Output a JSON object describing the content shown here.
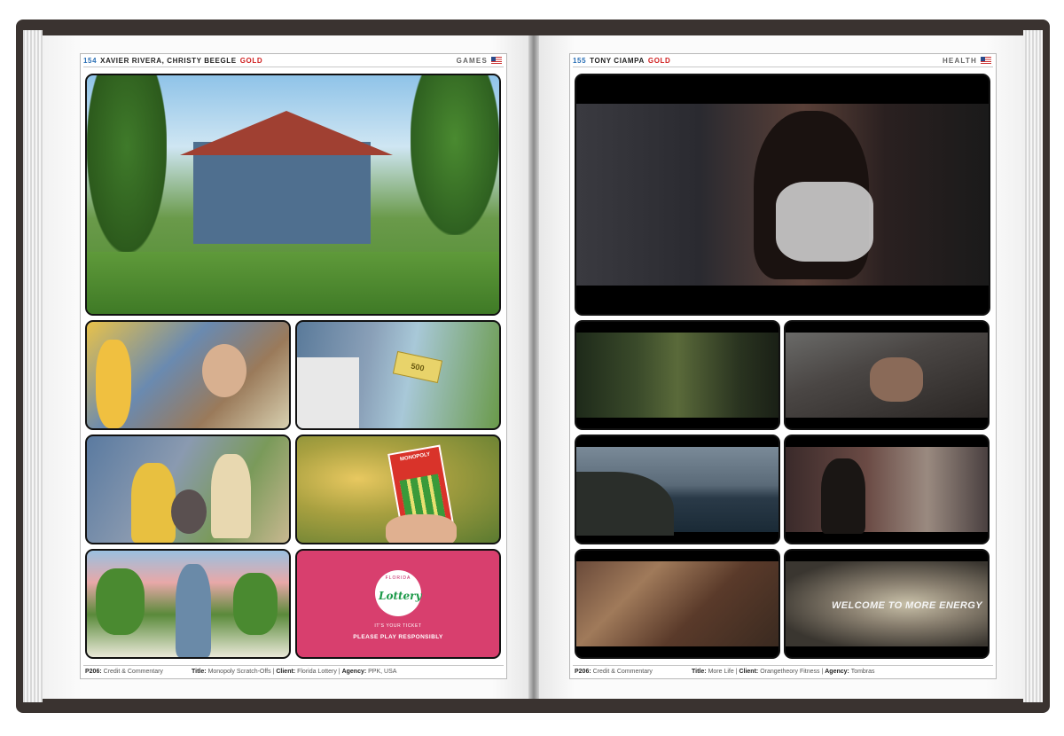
{
  "left_page": {
    "header": {
      "page_number": "154",
      "names": "XAVIER RIVERA, CHRISTY BEEGLE",
      "award": "GOLD",
      "category": "GAMES"
    },
    "footer": {
      "ref": "P206:",
      "ref_text": "Credit & Commentary",
      "title_label": "Title:",
      "title": "Monopoly Scratch-Offs",
      "client_label": "Client:",
      "client": "Florida Lottery",
      "agency_label": "Agency:",
      "agency": "PPK, USA"
    },
    "frames": [
      {
        "scene": "Blue craftsman house with red roof and green lawn"
      },
      {
        "scene": "Children with scratch ticket on porch"
      },
      {
        "scene": "Monopoly money flying past house"
      },
      {
        "scene": "Couple with dog sitting on porch"
      },
      {
        "scene": "Hands holding Monopoly scratch-off ticket"
      },
      {
        "scene": "Man in front of colorful houses and hedges"
      },
      {
        "scene": "Florida Lottery end card"
      }
    ],
    "bill_value": "500",
    "ticket_title": "MONOPOLY",
    "end_card": {
      "logo_top": "FLORIDA",
      "logo": "Lottery",
      "tagline": "IT'S YOUR TICKET",
      "cta": "PLEASE PLAY RESPONSIBLY"
    }
  },
  "right_page": {
    "header": {
      "page_number": "155",
      "names": "TONY CIAMPA",
      "award": "GOLD",
      "category": "HEALTH"
    },
    "footer": {
      "ref": "P206:",
      "ref_text": "Credit & Commentary",
      "title_label": "Title:",
      "title": "More Life",
      "client_label": "Client:",
      "client": "Orangetheory Fitness",
      "agency_label": "Agency:",
      "agency": "Tombras"
    },
    "overlay_text": "WELCOME TO MORE ENERGY",
    "colors": {
      "accent": "#d02020",
      "page_number": "#2a6fb5",
      "lottery_pink": "#d83f6e"
    }
  }
}
